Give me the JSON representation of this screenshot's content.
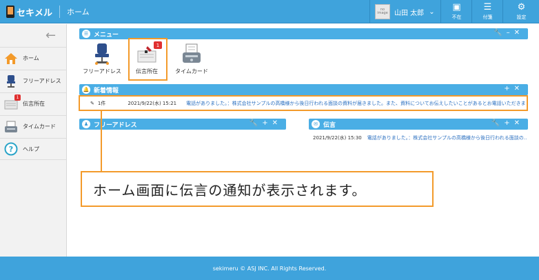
{
  "header": {
    "logo_text": "セキメル",
    "title": "ホーム",
    "avatar_text": "no image",
    "user_name": "山田 太郎",
    "buttons": [
      {
        "label": "不在",
        "icon": "absence-icon"
      },
      {
        "label": "付箋",
        "icon": "sticky-note-icon"
      },
      {
        "label": "設定",
        "icon": "gear-icon"
      }
    ]
  },
  "sidebar": {
    "items": [
      {
        "label": "ホーム",
        "icon": "home-icon"
      },
      {
        "label": "フリーアドレス",
        "icon": "chair-icon"
      },
      {
        "label": "伝言所在",
        "icon": "message-icon",
        "badge": "1"
      },
      {
        "label": "タイムカード",
        "icon": "timecard-icon"
      },
      {
        "label": "ヘルプ",
        "icon": "help-icon"
      }
    ]
  },
  "menu_panel": {
    "title": "メニュー",
    "items": [
      {
        "label": "フリーアドレス"
      },
      {
        "label": "伝言所在",
        "badge": "1"
      },
      {
        "label": "タイムカード"
      }
    ]
  },
  "news_panel": {
    "title": "新着情報",
    "count": "1件",
    "date": "2021/9/22(水) 15:21",
    "message": "電話がありました。：株式会社サンプルの高橋様から後日行われる面談の資料が届きました。また、資料についてお伝えしたいことがあるとお電話いただきました…"
  },
  "freeaddress_panel": {
    "title": "フリーアドレス"
  },
  "message_panel": {
    "title": "伝言",
    "date": "2021/9/22(水) 15:30",
    "message": "電話がありました。：株式会社サンプルの高橋様から後日行われる面談の…"
  },
  "callout": {
    "text": "ホーム画面に伝言の通知が表示されます。"
  },
  "footer": {
    "text": "sekimeru © ASJ INC. All Rights Reserved."
  },
  "colors": {
    "accent": "#3fa3dc",
    "highlight": "#f39a2a",
    "badge": "#e03030"
  }
}
